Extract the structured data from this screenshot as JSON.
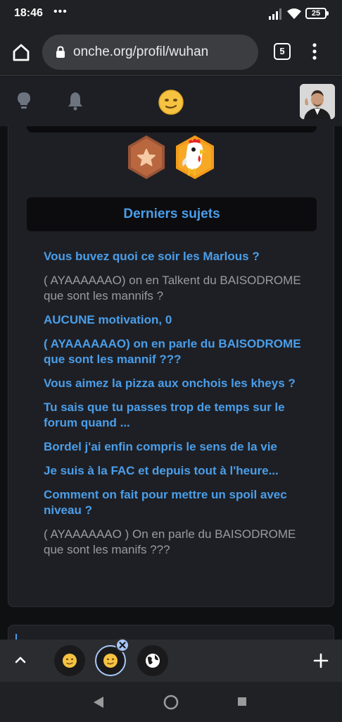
{
  "status_bar": {
    "time": "18:46",
    "dots": "•••",
    "battery": "25"
  },
  "toolbar": {
    "url": "onche.org/profil/wuhan",
    "tab_count": "5"
  },
  "profile": {
    "section_title": "Derniers sujets",
    "topics": [
      {
        "title": "Vous buvez quoi ce soir les Marlous ?",
        "state": "active"
      },
      {
        "title": "( AYAAAAAAO) on en Talkent du BAISODROME que sont les mannifs ?",
        "state": "inactive"
      },
      {
        "title": "AUCUNE motivation, 0",
        "state": "active"
      },
      {
        "title": "( AYAAAAAAO) on en parle du BAISODROME que sont les mannif ???",
        "state": "active"
      },
      {
        "title": "Vous aimez la pizza aux onchois les kheys ?",
        "state": "active"
      },
      {
        "title": "Tu sais que tu passes trop de temps sur le forum quand ...",
        "state": "active"
      },
      {
        "title": "Bordel j'ai enfin compris le sens de la vie",
        "state": "active"
      },
      {
        "title": "Je suis à la FAC et depuis tout à l'heure...",
        "state": "active"
      },
      {
        "title": "Comment on fait pour mettre un spoil avec niveau ?",
        "state": "active"
      },
      {
        "title": "( AYAAAAAAO ) On en parle du BAISODROME que sont les manifs ???",
        "state": "inactive"
      }
    ]
  },
  "colors": {
    "accent": "#4a9eea",
    "muted_text": "#9a9ba0",
    "card_bg": "#1e1f24"
  },
  "icons": {
    "home": "home-icon",
    "lock": "lock-icon",
    "menu": "more-vert-icon",
    "bulb": "lightbulb-icon",
    "bell": "bell-icon",
    "logo": "onche-smiley-logo-icon"
  }
}
